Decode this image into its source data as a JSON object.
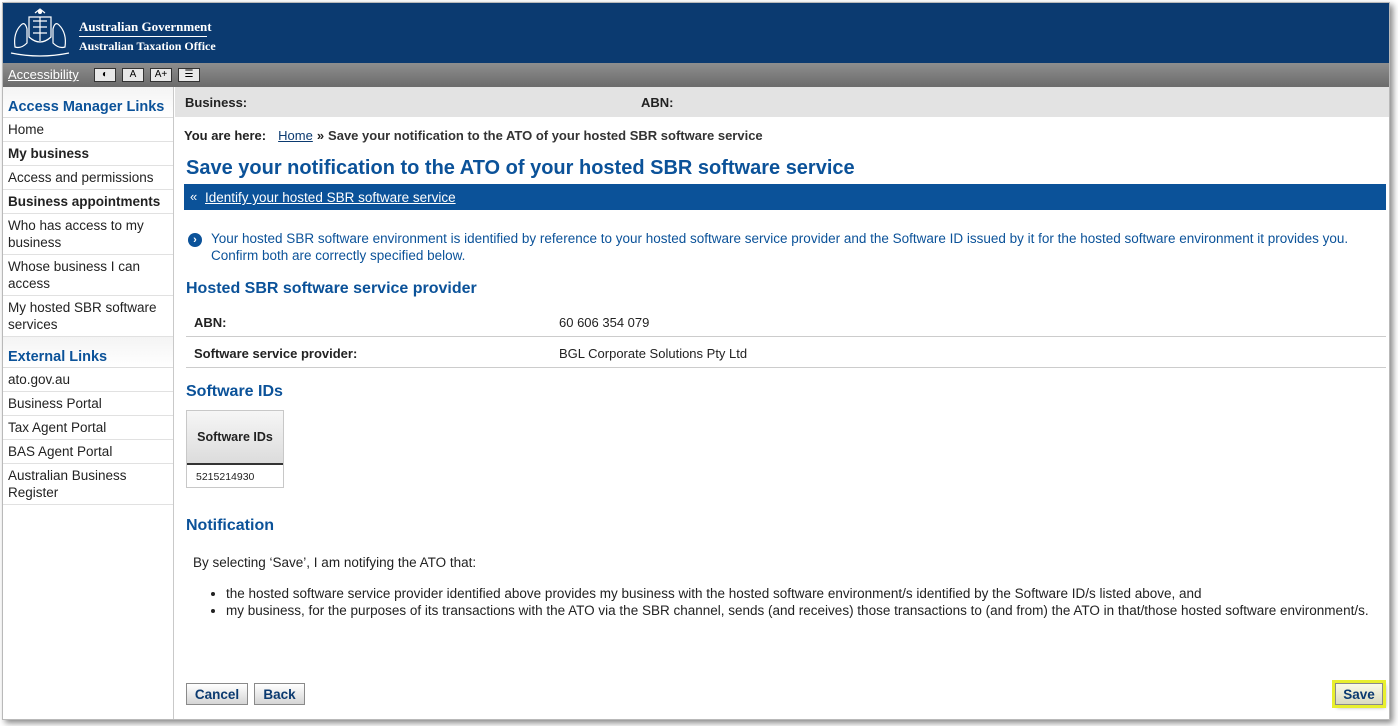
{
  "header": {
    "gov_line1": "Australian Government",
    "gov_line2": "Australian Taxation Office"
  },
  "accessibility": {
    "link": "Accessibility",
    "buttons": [
      "◐",
      "A",
      "A+",
      "☰"
    ]
  },
  "sidebar": {
    "access_heading": "Access Manager Links",
    "access_items": [
      {
        "label": "Home",
        "bold": false
      },
      {
        "label": "My business",
        "bold": true
      },
      {
        "label": "Access and permissions",
        "bold": false
      },
      {
        "label": "Business appointments",
        "bold": true
      },
      {
        "label": "Who has access to my business",
        "bold": false
      },
      {
        "label": "Whose business I can access",
        "bold": false
      },
      {
        "label": "My hosted SBR software services",
        "bold": false
      }
    ],
    "external_heading": "External Links",
    "external_items": [
      "ato.gov.au",
      "Business Portal",
      "Tax Agent Portal",
      "BAS Agent Portal",
      "Australian Business Register"
    ]
  },
  "bizbar": {
    "business_label": "Business:",
    "abn_label": "ABN:"
  },
  "breadcrumb": {
    "prefix": "You are here:",
    "home": "Home",
    "separator": "»",
    "current": "Save your notification to the ATO of your hosted SBR software service"
  },
  "page": {
    "title": "Save your notification to the ATO of your hosted SBR software service",
    "back_link": "Identify your hosted SBR software service",
    "info": "Your hosted SBR software environment is identified by reference to your hosted software service provider and the Software ID issued by it for the hosted software environment it provides you. Confirm both are correctly specified below."
  },
  "provider": {
    "heading": "Hosted SBR software service provider",
    "rows": [
      {
        "key": "ABN:",
        "value": "60 606 354 079"
      },
      {
        "key": "Software service provider:",
        "value": "BGL Corporate Solutions Pty Ltd"
      }
    ]
  },
  "software_ids": {
    "heading": "Software IDs",
    "column": "Software IDs",
    "values": [
      "5215214930"
    ]
  },
  "notification": {
    "heading": "Notification",
    "intro": "By selecting ‘Save’, I am notifying the ATO that:",
    "bullets": [
      "the hosted software service provider identified above provides my business with the hosted software environment/s identified by the Software ID/s listed above, and",
      "my business, for the purposes of its transactions with the ATO via the SBR channel, sends (and receives) those transactions to (and from) the ATO in that/those hosted software environment/s."
    ]
  },
  "buttons": {
    "cancel": "Cancel",
    "back": "Back",
    "save": "Save"
  },
  "colors": {
    "brand_navy": "#0b3a70",
    "accent_blue": "#0b5299",
    "highlight": "#e8ef2e"
  }
}
